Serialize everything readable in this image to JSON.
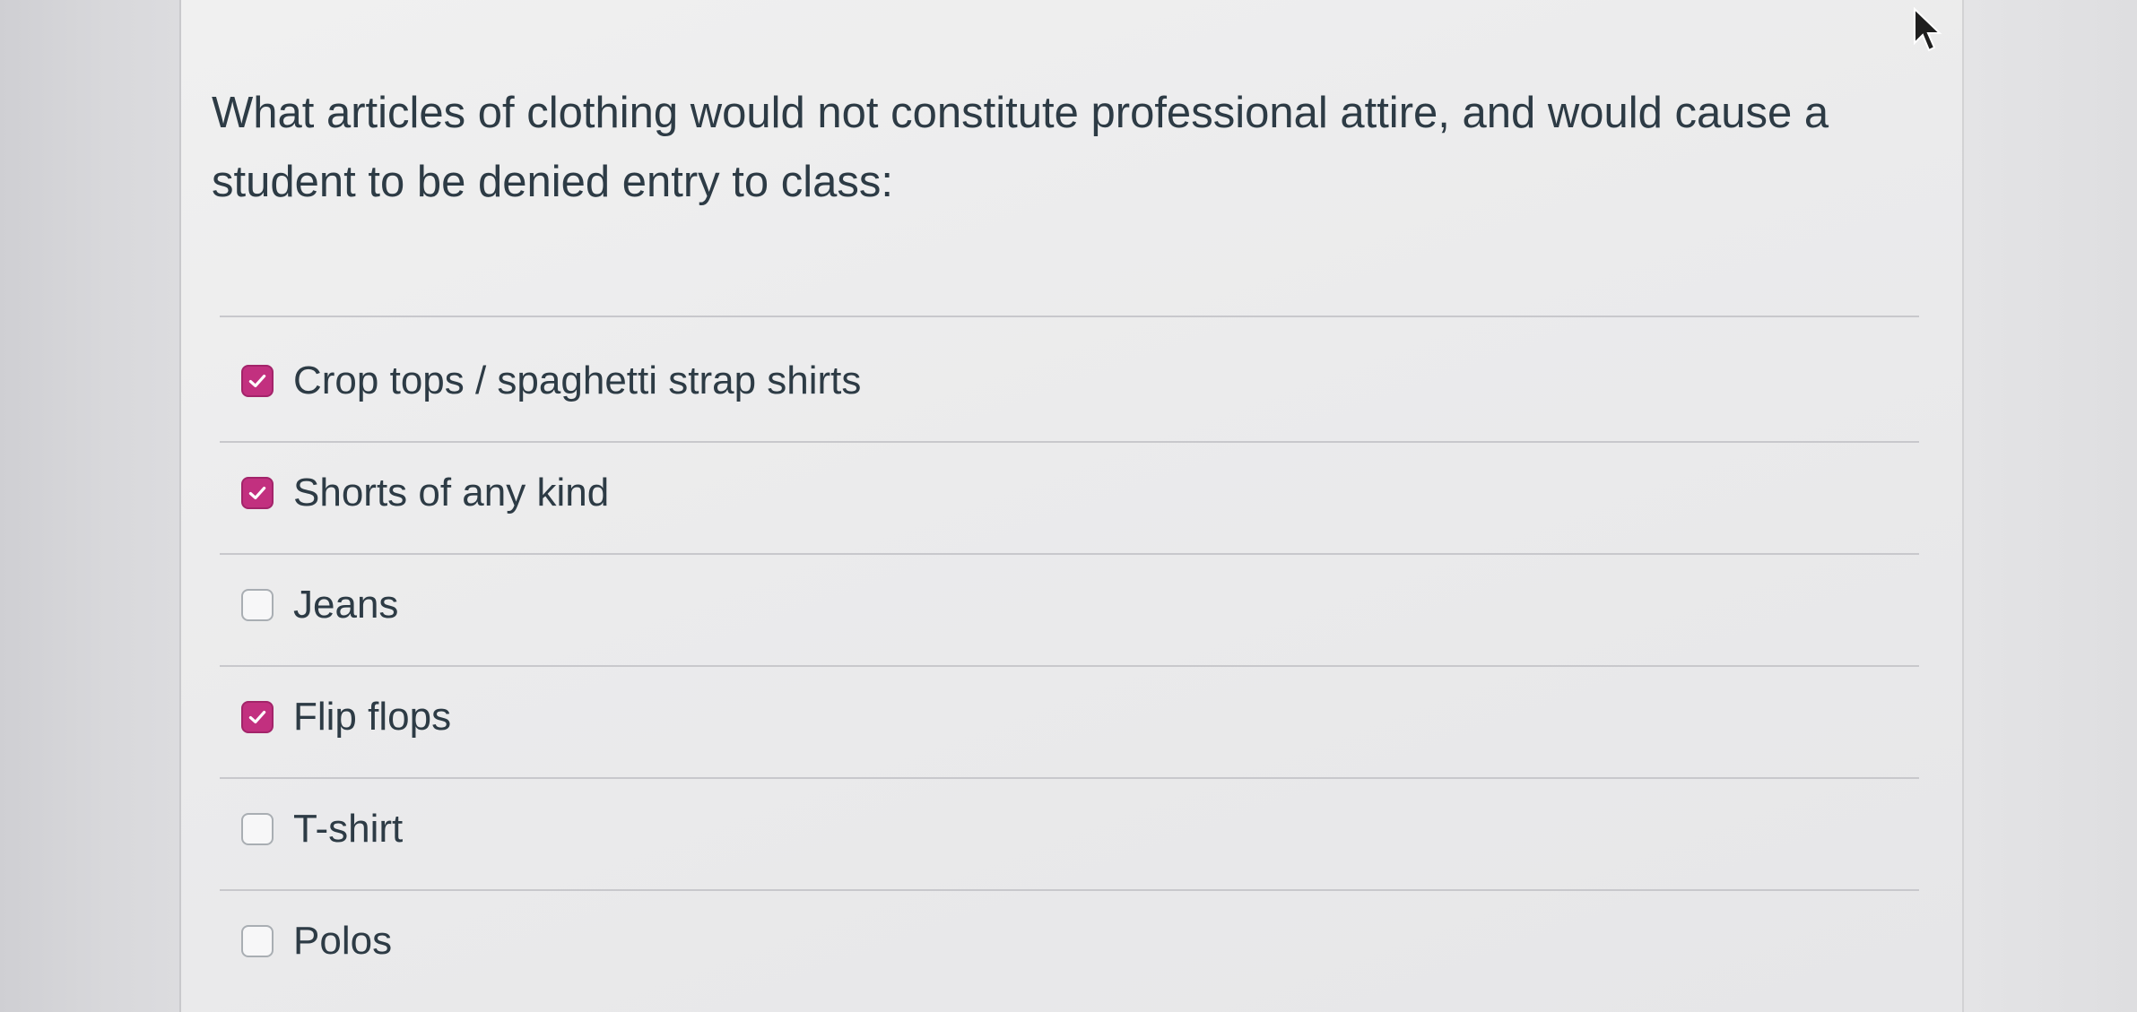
{
  "question": {
    "text": "What articles of clothing would not constitute professional attire, and would cause a student to be denied entry to class:"
  },
  "options": [
    {
      "label": "Crop tops / spaghetti strap shirts",
      "checked": true
    },
    {
      "label": "Shorts of any kind",
      "checked": true
    },
    {
      "label": "Jeans",
      "checked": false
    },
    {
      "label": "Flip flops",
      "checked": true
    },
    {
      "label": "T-shirt",
      "checked": false
    },
    {
      "label": "Polos",
      "checked": false
    }
  ],
  "colors": {
    "checkbox_checked": "#c2307f",
    "text": "#2d3b45"
  },
  "icons": {
    "check": "checkmark-icon",
    "cursor": "mouse-pointer-icon"
  }
}
